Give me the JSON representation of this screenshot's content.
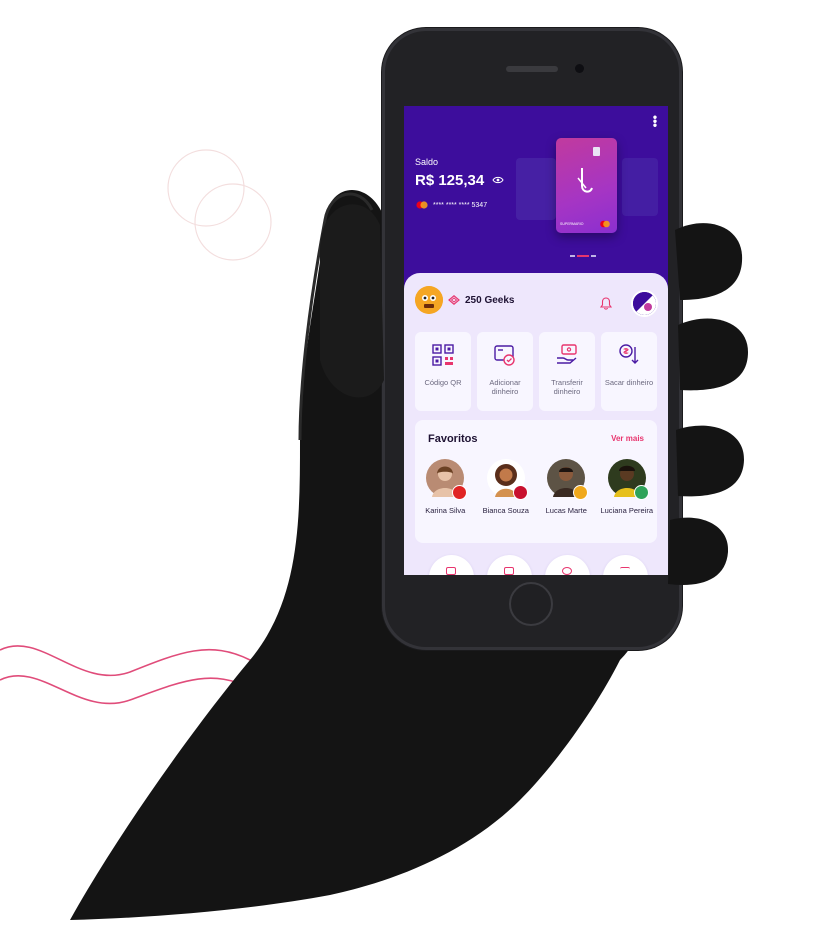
{
  "colors": {
    "header_purple": "#3d0d9c",
    "accent_pink": "#e8356e",
    "sheet_lilac": "#eee7fc",
    "hand": "#141414"
  },
  "header": {
    "menu_icon": "more-vertical-icon",
    "balance_label": "Saldo",
    "balance_amount": "R$ 125,34",
    "visibility_icon": "eye-icon",
    "card_number": "**** **** **** 5347",
    "card_brand_icon": "mastercard-icon",
    "card_holder": "SUPERMARIO",
    "carousel_active_index": 1,
    "carousel_count": 3
  },
  "rewards": {
    "geeks_label": "250 Geeks",
    "gem_icon": "diamond-icon",
    "notification_icon": "bell-icon"
  },
  "actions": [
    {
      "label": "Código QR",
      "icon": "qr-code-icon"
    },
    {
      "label": "Adicionar dinheiro",
      "icon": "add-money-icon"
    },
    {
      "label": "Transferir dinheiro",
      "icon": "transfer-icon"
    },
    {
      "label": "Sacar dinheiro",
      "icon": "withdraw-icon"
    }
  ],
  "favorites": {
    "title": "Favoritos",
    "see_more": "Ver mais",
    "people": [
      {
        "name": "Karina Silva",
        "avatar_color": "#b98b73",
        "bank_color": "#e02424"
      },
      {
        "name": "Bianca Souza",
        "avatar_color": "#c27a4a",
        "bank_color": "#c8102e"
      },
      {
        "name": "Lucas Marte",
        "avatar_color": "#6b4a36",
        "bank_color": "#f0a81c"
      },
      {
        "name": "Luciana Pereira",
        "avatar_color": "#4a3222",
        "bank_color": "#2fa35a"
      }
    ]
  }
}
